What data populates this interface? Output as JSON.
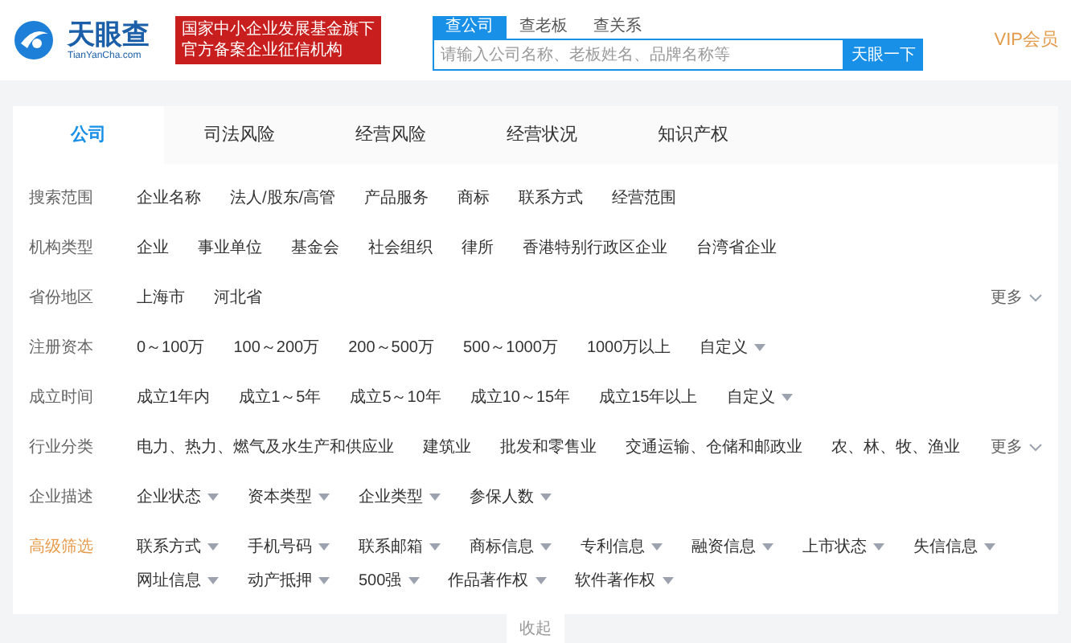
{
  "header": {
    "logo_text": "天眼查",
    "logo_domain": "TianYanCha.com",
    "badge_lines": [
      "国家中小企业发展基金旗下",
      "官方备案企业征信机构"
    ],
    "search_tabs": [
      {
        "label": "查公司",
        "selected": true
      },
      {
        "label": "查老板",
        "selected": false
      },
      {
        "label": "查关系",
        "selected": false
      }
    ],
    "search": {
      "placeholder": "请输入公司名称、老板姓名、品牌名称等"
    },
    "search_button": "天眼一下",
    "vip": "VIP会员"
  },
  "tabs": [
    {
      "label": "公司",
      "selected": true
    },
    {
      "label": "司法风险",
      "selected": false
    },
    {
      "label": "经营风险",
      "selected": false
    },
    {
      "label": "经营状况",
      "selected": false
    },
    {
      "label": "知识产权",
      "selected": false
    }
  ],
  "filters": [
    {
      "label": "搜索范围",
      "highlight": false,
      "options": [
        {
          "text": "企业名称",
          "kind": "plain"
        },
        {
          "text": "法人/股东/高管",
          "kind": "plain"
        },
        {
          "text": "产品服务",
          "kind": "plain"
        },
        {
          "text": "商标",
          "kind": "plain"
        },
        {
          "text": "联系方式",
          "kind": "plain"
        },
        {
          "text": "经营范围",
          "kind": "plain"
        }
      ]
    },
    {
      "label": "机构类型",
      "highlight": false,
      "options": [
        {
          "text": "企业",
          "kind": "plain"
        },
        {
          "text": "事业单位",
          "kind": "plain"
        },
        {
          "text": "基金会",
          "kind": "plain"
        },
        {
          "text": "社会组织",
          "kind": "plain"
        },
        {
          "text": "律所",
          "kind": "plain"
        },
        {
          "text": "香港特别行政区企业",
          "kind": "plain"
        },
        {
          "text": "台湾省企业",
          "kind": "plain"
        }
      ]
    },
    {
      "label": "省份地区",
      "highlight": false,
      "more": "更多",
      "options": [
        {
          "text": "上海市",
          "kind": "plain"
        },
        {
          "text": "河北省",
          "kind": "plain"
        }
      ]
    },
    {
      "label": "注册资本",
      "highlight": false,
      "options": [
        {
          "text": "0～100万",
          "kind": "plain"
        },
        {
          "text": "100～200万",
          "kind": "plain"
        },
        {
          "text": "200～500万",
          "kind": "plain"
        },
        {
          "text": "500～1000万",
          "kind": "plain"
        },
        {
          "text": "1000万以上",
          "kind": "plain"
        },
        {
          "text": "自定义",
          "kind": "dropdown"
        }
      ]
    },
    {
      "label": "成立时间",
      "highlight": false,
      "options": [
        {
          "text": "成立1年内",
          "kind": "plain"
        },
        {
          "text": "成立1～5年",
          "kind": "plain"
        },
        {
          "text": "成立5～10年",
          "kind": "plain"
        },
        {
          "text": "成立10～15年",
          "kind": "plain"
        },
        {
          "text": "成立15年以上",
          "kind": "plain"
        },
        {
          "text": "自定义",
          "kind": "dropdown"
        }
      ]
    },
    {
      "label": "行业分类",
      "highlight": false,
      "more": "更多",
      "options": [
        {
          "text": "电力、热力、燃气及水生产和供应业",
          "kind": "plain"
        },
        {
          "text": "建筑业",
          "kind": "plain"
        },
        {
          "text": "批发和零售业",
          "kind": "plain"
        },
        {
          "text": "交通运输、仓储和邮政业",
          "kind": "plain"
        },
        {
          "text": "农、林、牧、渔业",
          "kind": "plain"
        }
      ]
    },
    {
      "label": "企业描述",
      "highlight": false,
      "options": [
        {
          "text": "企业状态",
          "kind": "dropdown"
        },
        {
          "text": "资本类型",
          "kind": "dropdown"
        },
        {
          "text": "企业类型",
          "kind": "dropdown"
        },
        {
          "text": "参保人数",
          "kind": "dropdown"
        }
      ]
    },
    {
      "label": "高级筛选",
      "highlight": true,
      "options": [
        {
          "text": "联系方式",
          "kind": "dropdown"
        },
        {
          "text": "手机号码",
          "kind": "dropdown"
        },
        {
          "text": "联系邮箱",
          "kind": "dropdown"
        },
        {
          "text": "商标信息",
          "kind": "dropdown"
        },
        {
          "text": "专利信息",
          "kind": "dropdown"
        },
        {
          "text": "融资信息",
          "kind": "dropdown"
        },
        {
          "text": "上市状态",
          "kind": "dropdown"
        },
        {
          "text": "失信信息",
          "kind": "dropdown"
        },
        {
          "text": "网址信息",
          "kind": "dropdown"
        },
        {
          "text": "动产抵押",
          "kind": "dropdown"
        },
        {
          "text": "500强",
          "kind": "dropdown"
        },
        {
          "text": "作品著作权",
          "kind": "dropdown"
        },
        {
          "text": "软件著作权",
          "kind": "dropdown"
        }
      ]
    }
  ],
  "collapse": "收起"
}
